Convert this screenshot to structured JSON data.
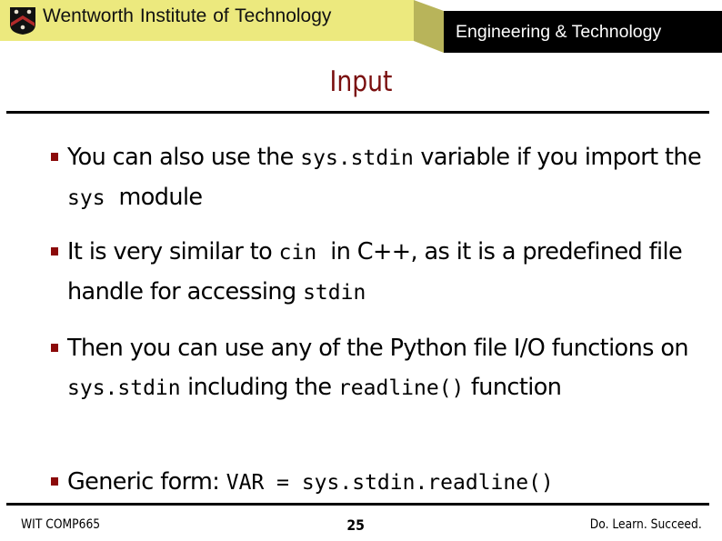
{
  "header": {
    "org_name": "Wentworth Institute of Technology",
    "dept_name": "Engineering & Technology",
    "logo_icon": "shield-crest-icon",
    "colors": {
      "bar": "#ece97e",
      "fold": "#b8b45a",
      "dept_bg": "#000000",
      "crest": "#111111",
      "chevron": "#b22a2a"
    }
  },
  "slide": {
    "title": "Input",
    "title_color": "#7a0f0f",
    "bullet_color": "#8b0a0a",
    "bullets": [
      {
        "parts": [
          {
            "t": "You can also use the ",
            "code": false
          },
          {
            "t": "sys.stdin",
            "code": true
          },
          {
            "t": " variable if you import the ",
            "code": false
          },
          {
            "t": "sys",
            "code": true
          },
          {
            "t": "  module",
            "code": false
          }
        ]
      },
      {
        "parts": [
          {
            "t": "It is very similar to ",
            "code": false
          },
          {
            "t": "cin",
            "code": true
          },
          {
            "t": "  in C++, as it is a predefined file handle for accessing ",
            "code": false
          },
          {
            "t": "stdin",
            "code": true
          }
        ]
      },
      {
        "parts": [
          {
            "t": "Then you can use any of the Python file I/O functions on ",
            "code": false
          },
          {
            "t": "sys.stdin",
            "code": true
          },
          {
            "t": " including the ",
            "code": false
          },
          {
            "t": "readline()",
            "code": true
          },
          {
            "t": " function",
            "code": false
          }
        ]
      },
      {
        "parts": [
          {
            "t": "Generic form: ",
            "code": false
          },
          {
            "t": "VAR = sys.stdin.readline()",
            "code": true
          }
        ]
      }
    ]
  },
  "footer": {
    "course": "WIT COMP665",
    "page_number": "25",
    "motto": "Do. Learn. Succeed."
  }
}
